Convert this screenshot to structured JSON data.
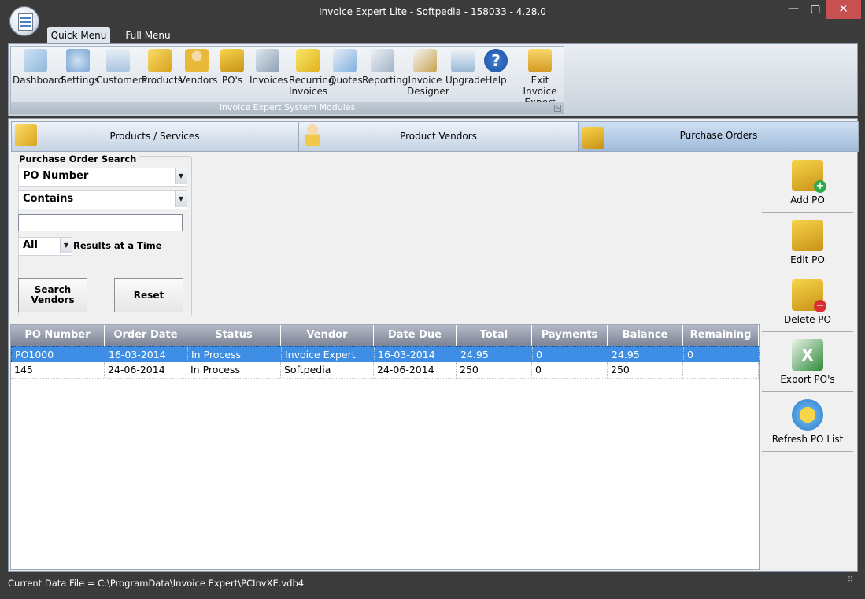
{
  "window": {
    "title": "Invoice Expert Lite - Softpedia - 158033 - 4.28.0",
    "min": "—",
    "max": "▢",
    "close": "✕"
  },
  "ribbon": {
    "tabs": [
      "Quick Menu",
      "Full Menu"
    ],
    "buttons": [
      {
        "label": "Dashboard",
        "icon": "dashboard-icon"
      },
      {
        "label": "Settings",
        "icon": "gear-icon"
      },
      {
        "label": "Customers",
        "icon": "customers-icon"
      },
      {
        "label": "Products",
        "icon": "products-icon"
      },
      {
        "label": "Vendors",
        "icon": "vendors-icon"
      },
      {
        "label": "PO's",
        "icon": "purchase-orders-icon"
      },
      {
        "label": "Invoices",
        "icon": "cart-icon"
      },
      {
        "label": "Recurring\nInvoices",
        "icon": "recurring-invoices-icon"
      },
      {
        "label": "Quotes",
        "icon": "quotes-icon"
      },
      {
        "label": "Reporting",
        "icon": "reporting-icon"
      },
      {
        "label": "Invoice\nDesigner",
        "icon": "designer-icon"
      },
      {
        "label": "Upgrade",
        "icon": "upgrade-icon"
      },
      {
        "label": "Help",
        "icon": "help-icon"
      },
      {
        "label": "Exit Invoice\nExpert",
        "icon": "exit-icon"
      }
    ],
    "group_caption": "Invoice Expert System Modules"
  },
  "tabs": {
    "products": "Products / Services",
    "vendors": "Product Vendors",
    "po": "Purchase Orders"
  },
  "search": {
    "legend": "Purchase Order Search",
    "field": "PO Number",
    "operator": "Contains",
    "text": "",
    "results_count": "All",
    "results_label": "Results at a Time",
    "search_button": "Search\nVendors",
    "reset_button": "Reset"
  },
  "grid": {
    "columns": [
      "PO Number",
      "Order Date",
      "Status",
      "Vendor",
      "Date Due",
      "Total",
      "Payments",
      "Balance",
      "Remaining"
    ],
    "rows": [
      [
        "PO1000",
        "16-03-2014",
        "In Process",
        "Invoice Expert",
        "16-03-2014",
        "24.95",
        "0",
        "24.95",
        "0"
      ],
      [
        "145",
        "24-06-2014",
        "In Process",
        "Softpedia",
        "24-06-2014",
        "250",
        "0",
        "250",
        ""
      ]
    ]
  },
  "actions": [
    {
      "label": "Add PO",
      "icon": "add-po-icon"
    },
    {
      "label": "Edit PO",
      "icon": "edit-po-icon"
    },
    {
      "label": "Delete PO",
      "icon": "delete-po-icon"
    },
    {
      "label": "Export PO's",
      "icon": "excel-export-icon"
    },
    {
      "label": "Refresh PO List",
      "icon": "refresh-icon"
    }
  ],
  "status": {
    "text": "Current Data File = C:\\ProgramData\\Invoice Expert\\PCInvXE.vdb4"
  },
  "colors": {
    "selection": "#3d8ee4",
    "header": "#7e8597",
    "frame": "#3b3b3b",
    "close": "#c75050"
  }
}
